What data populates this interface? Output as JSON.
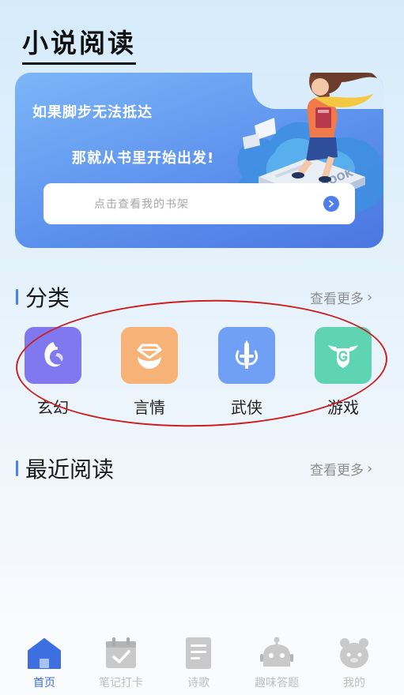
{
  "app": {
    "title": "小说阅读"
  },
  "banner": {
    "line1": "如果脚步无法抵达",
    "line2": "那就从书里开始出发!",
    "bookshelf_label": "点击查看我的书架",
    "book_text": "BOOK"
  },
  "categories": {
    "title": "分类",
    "more": "查看更多",
    "items": [
      {
        "label": "玄幻",
        "icon": "phoenix-icon",
        "color": "#7f78ef"
      },
      {
        "label": "言情",
        "icon": "diamond-ring-icon",
        "color": "#f6b277"
      },
      {
        "label": "武侠",
        "icon": "sword-icon",
        "color": "#6fa0f5"
      },
      {
        "label": "游戏",
        "icon": "game-shield-icon",
        "color": "#5fd4b3"
      }
    ]
  },
  "recent": {
    "title": "最近阅读",
    "more": "查看更多"
  },
  "tabs": [
    {
      "label": "首页",
      "icon": "home-icon",
      "active": true
    },
    {
      "label": "笔记打卡",
      "icon": "calendar-check-icon",
      "active": false
    },
    {
      "label": "诗歌",
      "icon": "document-icon",
      "active": false
    },
    {
      "label": "趣味答题",
      "icon": "robot-icon",
      "active": false
    },
    {
      "label": "我的",
      "icon": "user-bear-icon",
      "active": false
    }
  ],
  "colors": {
    "accent": "#3d6fe0",
    "annotation": "#cc1f1f"
  }
}
